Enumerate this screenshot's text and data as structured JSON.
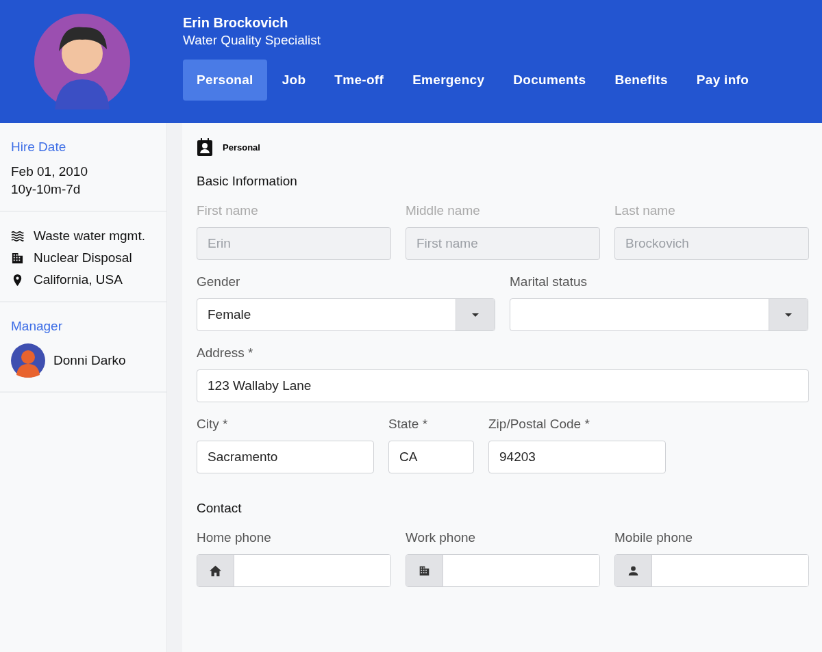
{
  "profile": {
    "name": "Erin Brockovich",
    "title": "Water Quality Specialist"
  },
  "tabs": [
    {
      "label": "Personal",
      "selected": true
    },
    {
      "label": "Job",
      "selected": false
    },
    {
      "label": "Tme-off",
      "selected": false
    },
    {
      "label": "Emergency",
      "selected": false
    },
    {
      "label": "Documents",
      "selected": false
    },
    {
      "label": "Benefits",
      "selected": false
    },
    {
      "label": "Pay info",
      "selected": false
    }
  ],
  "sidebar": {
    "hire_date_label": "Hire Date",
    "hire_date": "Feb 01, 2010",
    "tenure": "10y-10m-7d",
    "details": [
      {
        "kind": "department",
        "text": "Waste water mgmt."
      },
      {
        "kind": "division",
        "text": "Nuclear Disposal"
      },
      {
        "kind": "location",
        "text": "California, USA"
      }
    ],
    "manager_label": "Manager",
    "manager_name": "Donni Darko"
  },
  "section_title": "Personal",
  "basic_info": {
    "heading": "Basic Information",
    "name_fields": [
      {
        "label": "First name",
        "value": "Erin",
        "disabled": true
      },
      {
        "label": "Middle name",
        "placeholder": "First name",
        "disabled": true
      },
      {
        "label": "Last name",
        "value": "Brockovich",
        "disabled": true
      }
    ],
    "selects": [
      {
        "label": "Gender",
        "value": "Female"
      },
      {
        "label": "Marital status"
      }
    ],
    "address": {
      "label": "Address *",
      "value": "123 Wallaby Lane"
    },
    "city_fields": [
      {
        "label": "City *",
        "value": "Sacramento"
      },
      {
        "label": "State *",
        "value": "CA"
      },
      {
        "label": "Zip/Postal Code *",
        "value": "94203"
      }
    ]
  },
  "contact": {
    "heading": "Contact",
    "phones": [
      {
        "label": "Home phone",
        "kind": "home"
      },
      {
        "label": "Work phone",
        "kind": "work"
      },
      {
        "label": "Mobile phone",
        "kind": "mobile"
      }
    ]
  }
}
